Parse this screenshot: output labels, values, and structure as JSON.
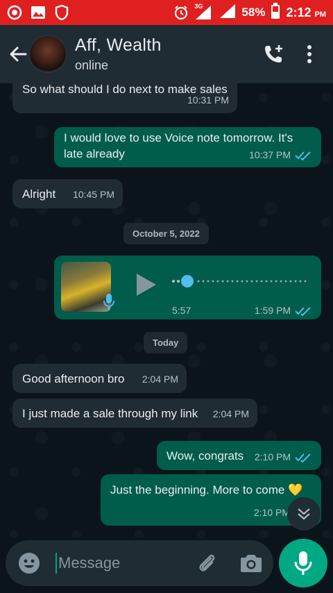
{
  "status_bar": {
    "battery": "58%",
    "network": "3G",
    "time": "2:12",
    "ampm": "PM"
  },
  "header": {
    "contact_name": "Aff, Wealth",
    "contact_status": "online"
  },
  "messages": [
    {
      "dir": "in",
      "text": "So what should I do next to make sales",
      "time": "10:31 PM"
    },
    {
      "dir": "out",
      "text": "I would love to use Voice note tomorrow. It's late already",
      "time": "10:37 PM",
      "read": true
    },
    {
      "dir": "in",
      "text": "Alright",
      "time": "10:45 PM"
    },
    {
      "dir": "date",
      "text": "October 5, 2022"
    },
    {
      "dir": "out",
      "type": "voice",
      "duration": "5:57",
      "time": "1:59 PM",
      "read": true
    },
    {
      "dir": "date",
      "text": "Today"
    },
    {
      "dir": "in",
      "text": "Good afternoon bro",
      "time": "2:04 PM"
    },
    {
      "dir": "in",
      "text": "I just made a sale through my link",
      "time": "2:04 PM"
    },
    {
      "dir": "out",
      "text": "Wow, congrats",
      "time": "2:10 PM",
      "read": true
    },
    {
      "dir": "out",
      "text": "Just the beginning. More to come",
      "emoji": "💛",
      "time": "2:10 PM"
    }
  ],
  "composer": {
    "placeholder": "Message"
  },
  "colors": {
    "status_bar": "#e02020",
    "app_bar": "#1f2c34",
    "chat_bg": "#0b141a",
    "incoming": "#202c33",
    "outgoing": "#005c4b",
    "accent": "#00a884",
    "read_ticks": "#53bdeb"
  },
  "icons": [
    "screen-record-icon",
    "gallery-icon",
    "shield-icon",
    "alarm-icon",
    "signal-icon",
    "battery-icon",
    "back-arrow-icon",
    "add-call-icon",
    "more-vert-icon",
    "play-icon",
    "mic-badge-icon",
    "double-check-icon",
    "emoji-icon",
    "attach-icon",
    "camera-icon",
    "mic-icon",
    "chevron-double-down-icon"
  ]
}
